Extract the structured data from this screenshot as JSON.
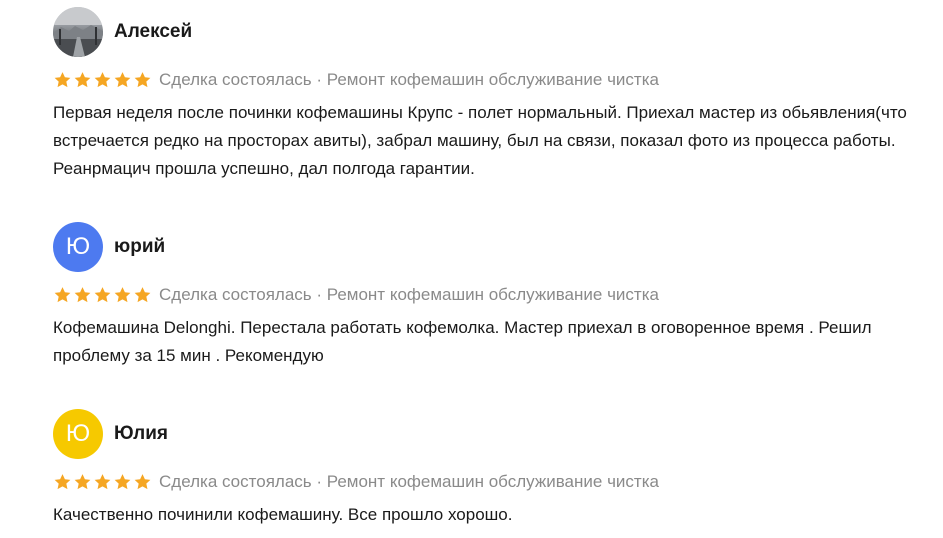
{
  "reviews": [
    {
      "author": "Алексей",
      "avatar_type": "photo",
      "avatar_letter": "",
      "avatar_color": "#8c9095",
      "rating": 5,
      "meta": "Сделка состоялась · Ремонт кофемашин обслуживание чистка",
      "text": "Первая неделя после починки кофемашины Крупс - полет нормальный. Приехал мастер из обьявления(что встречается редко на просторах авиты), забрал машину, был на связи, показал фото из процесса работы. Реанрмацич прошла успешно, дал полгода гарантии."
    },
    {
      "author": "юрий",
      "avatar_type": "letter",
      "avatar_letter": "Ю",
      "avatar_color": "#4d7af0",
      "rating": 5,
      "meta": "Сделка состоялась · Ремонт кофемашин обслуживание чистка",
      "text": "Кофемашина Delonghi. Перестала работать кофемолка. Мастер приехал в оговоренное время . Решил проблему за 15 мин . Рекомендую"
    },
    {
      "author": "Юлия",
      "avatar_type": "letter",
      "avatar_letter": "Ю",
      "avatar_color": "#f6c900",
      "rating": 5,
      "meta": "Сделка состоялась · Ремонт кофемашин обслуживание чистка",
      "text": "Качественно починили кофемашину. Все прошло хорошо."
    }
  ],
  "colors": {
    "star": "#f5a623",
    "meta": "#8a8a8a",
    "text": "#1a1a1a"
  }
}
